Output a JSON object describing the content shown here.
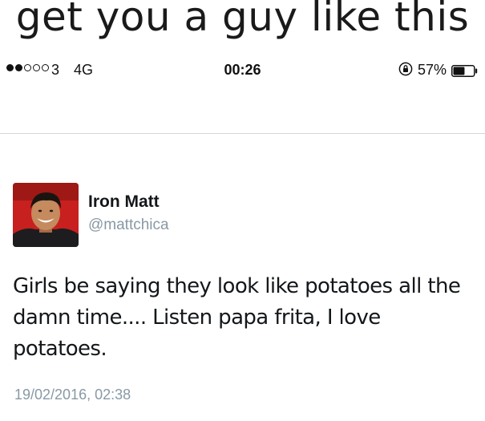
{
  "caption": "get you a guy like this",
  "status_bar": {
    "carrier": "3",
    "network": "4G",
    "time": "00:26",
    "battery_percent": "57%",
    "battery_level": 0.57,
    "signal_strength": 2,
    "signal_max": 5
  },
  "tweet": {
    "display_name": "Iron Matt",
    "handle": "@mattchica",
    "text": "Girls be saying they look like potatoes all the damn time.... Listen papa frita, I love potatoes.",
    "timestamp": "19/02/2016, 02:38"
  },
  "colors": {
    "handle_gray": "#8899a6",
    "text_dark": "#14171a",
    "avatar_red": "#c8201e"
  }
}
